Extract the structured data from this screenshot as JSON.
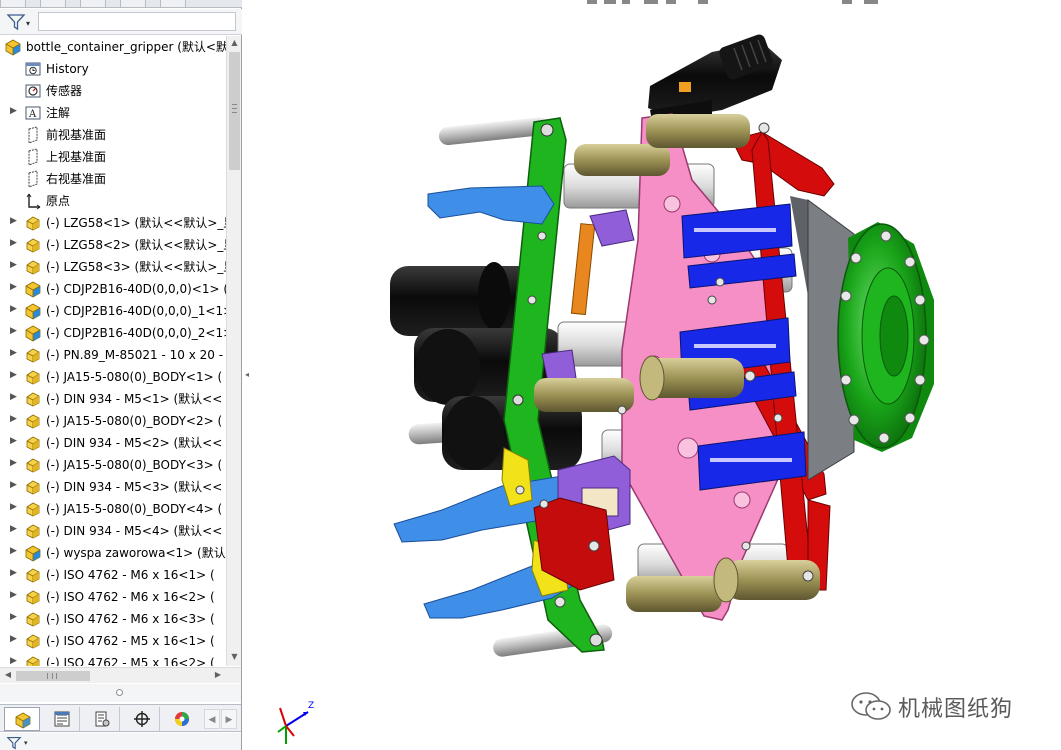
{
  "panel": {
    "filter_icon": "filter-icon",
    "tree": [
      {
        "label": "bottle_container_gripper  (默认<默",
        "icon": "assembly-icon",
        "type": "root",
        "expandable": false,
        "indent": 0
      },
      {
        "label": "History",
        "icon": "history-icon",
        "type": "folder",
        "expandable": false,
        "indent": 1
      },
      {
        "label": "传感器",
        "icon": "sensor-icon",
        "type": "folder",
        "expandable": false,
        "indent": 1
      },
      {
        "label": "注解",
        "icon": "annotation-icon",
        "type": "folder",
        "expandable": true,
        "indent": 1
      },
      {
        "label": "前视基准面",
        "icon": "plane-icon",
        "type": "plane",
        "expandable": false,
        "indent": 1
      },
      {
        "label": "上视基准面",
        "icon": "plane-icon",
        "type": "plane",
        "expandable": false,
        "indent": 1
      },
      {
        "label": "右视基准面",
        "icon": "plane-icon",
        "type": "plane",
        "expandable": false,
        "indent": 1
      },
      {
        "label": "原点",
        "icon": "origin-icon",
        "type": "origin",
        "expandable": false,
        "indent": 1
      },
      {
        "label": "(-) LZG58<1> (默认<<默认>_显",
        "icon": "part-icon",
        "type": "part",
        "expandable": true,
        "indent": 1
      },
      {
        "label": "(-) LZG58<2> (默认<<默认>_显",
        "icon": "part-icon",
        "type": "part",
        "expandable": true,
        "indent": 1
      },
      {
        "label": "(-) LZG58<3> (默认<<默认>_显",
        "icon": "part-icon",
        "type": "part",
        "expandable": true,
        "indent": 1
      },
      {
        "label": "(-) CDJP2B16-40D(0,0,0)<1> (",
        "icon": "subassembly-icon",
        "type": "asm",
        "expandable": true,
        "indent": 1
      },
      {
        "label": "(-) CDJP2B16-40D(0,0,0)_1<1>",
        "icon": "subassembly-icon",
        "type": "asm",
        "expandable": true,
        "indent": 1
      },
      {
        "label": "(-) CDJP2B16-40D(0,0,0)_2<1>",
        "icon": "subassembly-icon",
        "type": "asm",
        "expandable": true,
        "indent": 1
      },
      {
        "label": "(-) PN.89_M-85021 - 10 x 20 -",
        "icon": "part-icon",
        "type": "part",
        "expandable": true,
        "indent": 1
      },
      {
        "label": "(-) JA15-5-080(0)_BODY<1> (",
        "icon": "part-icon",
        "type": "part",
        "expandable": true,
        "indent": 1
      },
      {
        "label": "(-) DIN 934 - M5<1> (默认<<",
        "icon": "part-icon",
        "type": "part",
        "expandable": true,
        "indent": 1
      },
      {
        "label": "(-) JA15-5-080(0)_BODY<2> (",
        "icon": "part-icon",
        "type": "part",
        "expandable": true,
        "indent": 1
      },
      {
        "label": "(-) DIN 934 - M5<2> (默认<<",
        "icon": "part-icon",
        "type": "part",
        "expandable": true,
        "indent": 1
      },
      {
        "label": "(-) JA15-5-080(0)_BODY<3> (",
        "icon": "part-icon",
        "type": "part",
        "expandable": true,
        "indent": 1
      },
      {
        "label": "(-) DIN 934 - M5<3> (默认<<",
        "icon": "part-icon",
        "type": "part",
        "expandable": true,
        "indent": 1
      },
      {
        "label": "(-) JA15-5-080(0)_BODY<4> (",
        "icon": "part-icon",
        "type": "part",
        "expandable": true,
        "indent": 1
      },
      {
        "label": "(-) DIN 934 - M5<4> (默认<<",
        "icon": "part-icon",
        "type": "part",
        "expandable": true,
        "indent": 1
      },
      {
        "label": "(-) wyspa zaworowa<1> (默认",
        "icon": "subassembly-icon",
        "type": "asm",
        "expandable": true,
        "indent": 1
      },
      {
        "label": "(-) ISO 4762  - M6 x 16<1> (",
        "icon": "part-icon",
        "type": "part",
        "expandable": true,
        "indent": 1
      },
      {
        "label": "(-) ISO 4762  - M6 x 16<2> (",
        "icon": "part-icon",
        "type": "part",
        "expandable": true,
        "indent": 1
      },
      {
        "label": "(-) ISO 4762  - M6 x 16<3> (",
        "icon": "part-icon",
        "type": "part",
        "expandable": true,
        "indent": 1
      },
      {
        "label": "(-) ISO 4762  - M5 x 16<1> (",
        "icon": "part-icon",
        "type": "part",
        "expandable": true,
        "indent": 1
      },
      {
        "label": "(-) ISO 4762  - M5 x 16<2> (",
        "icon": "part-icon",
        "type": "part",
        "expandable": true,
        "indent": 1
      }
    ],
    "bottom_tabs": [
      {
        "name": "featuremanager-tab",
        "icon": "assembly-icon"
      },
      {
        "name": "propertymanager-tab",
        "icon": "property-icon"
      },
      {
        "name": "configurationmanager-tab",
        "icon": "configuration-icon"
      },
      {
        "name": "dimxpert-tab",
        "icon": "crosshair-icon"
      },
      {
        "name": "display-manager-tab",
        "icon": "appearance-icon"
      }
    ]
  },
  "viewport": {
    "triad_axis_label": "Z",
    "watermark_text": "机械图纸狗",
    "colors": {
      "green": "#1fb51f",
      "pink": "#f58fc6",
      "red": "#d40c0c",
      "blue": "#1828e8",
      "gray": "#7b7e83",
      "black": "#101010",
      "purple": "#8f5ed8",
      "lightblue": "#3f8ee8",
      "yellow": "#f2e21a",
      "orange": "#e8871f",
      "olive": "#a49a5c"
    }
  }
}
